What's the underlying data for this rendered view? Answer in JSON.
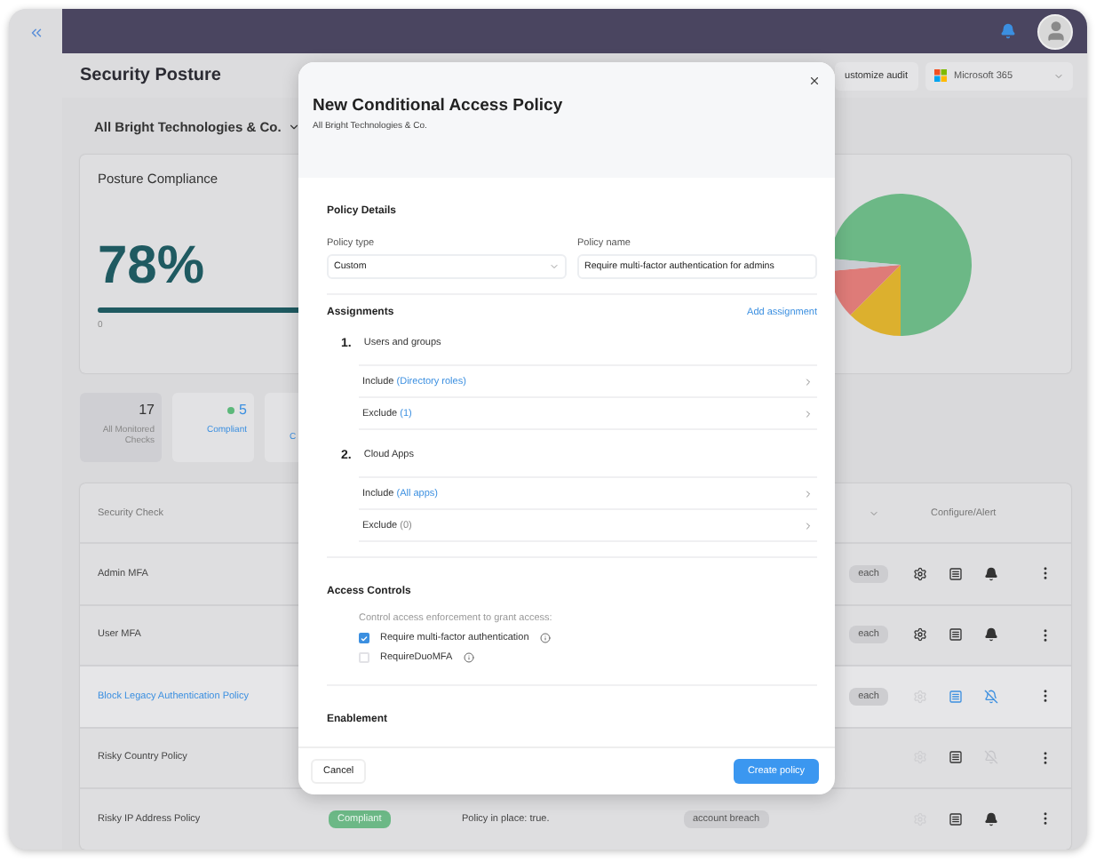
{
  "page": {
    "title": "Security Posture",
    "customize_button": "ustomize audit",
    "platform_select": "Microsoft 365",
    "organization_filter": "All Bright Technologies & Co."
  },
  "posture_card": {
    "title": "Posture Compliance",
    "percentage": "78%",
    "scale_min": "0",
    "level": 0.78
  },
  "stat_tiles": [
    {
      "kind": "total",
      "value": "17",
      "label": "All Monitored Checks",
      "selected": true
    },
    {
      "kind": "status",
      "value": "5",
      "label": "Compliant",
      "selected": false
    },
    {
      "kind": "status",
      "label": "C",
      "selected": false
    }
  ],
  "table": {
    "columns": [
      {
        "label": "Security Check"
      },
      {
        "label": "Configure/Alert"
      }
    ],
    "rows": [
      {
        "kind": "behind-dialog",
        "name": "Admin MFA",
        "tag": "each",
        "selected": false,
        "configurable": true,
        "alert_muted": false
      },
      {
        "kind": "behind-dialog",
        "name": "User MFA",
        "tag": "each",
        "selected": false,
        "configurable": true,
        "alert_muted": false
      },
      {
        "kind": "behind-dialog",
        "name": "Block Legacy Authentication Policy",
        "tag": "each",
        "selected": true,
        "configurable": false,
        "alert_muted": true
      },
      {
        "kind": "behind-dialog",
        "name": "Risky Country Policy",
        "selected": false,
        "configurable": false,
        "alert_muted": true
      },
      {
        "kind": "full",
        "name": "Risky IP Address Policy",
        "status": "Compliant",
        "details": "Policy in place: true.",
        "tag": "account breach",
        "selected": false,
        "configurable": false,
        "alert_muted": false
      }
    ]
  },
  "dialog": {
    "title": "New Conditional Access Policy",
    "subtitle": "All Bright Technologies & Co.",
    "policy_details": {
      "heading": "Policy Details",
      "fields": [
        {
          "kind": "select",
          "label": "Policy type",
          "value": "Custom"
        },
        {
          "kind": "text",
          "label": "Policy name",
          "value": "Require multi-factor authentication for admins"
        }
      ]
    },
    "assignments": {
      "heading": "Assignments",
      "action": "Add assignment",
      "groups": [
        {
          "number": "1.",
          "title": "Users and groups",
          "rows": [
            {
              "label": "Include",
              "detail": "(Directory roles)",
              "detail_link": true
            },
            {
              "label": "Exclude",
              "detail": "(1)",
              "detail_link": true
            }
          ]
        },
        {
          "number": "2.",
          "title": "Cloud Apps",
          "rows": [
            {
              "label": "Include",
              "detail": "(All apps)",
              "detail_link": true
            },
            {
              "label": "Exclude",
              "detail": "(0)",
              "detail_link": false
            }
          ]
        }
      ]
    },
    "access_controls": {
      "heading": "Access Controls",
      "hint": "Control access enforcement to grant access:",
      "options": [
        {
          "label": "Require multi-factor authentication",
          "checked": true
        },
        {
          "label": "RequireDuoMFA",
          "checked": false
        }
      ]
    },
    "enablement": {
      "heading": "Enablement"
    },
    "buttons": {
      "cancel": "Cancel",
      "submit": "Create policy"
    }
  }
}
